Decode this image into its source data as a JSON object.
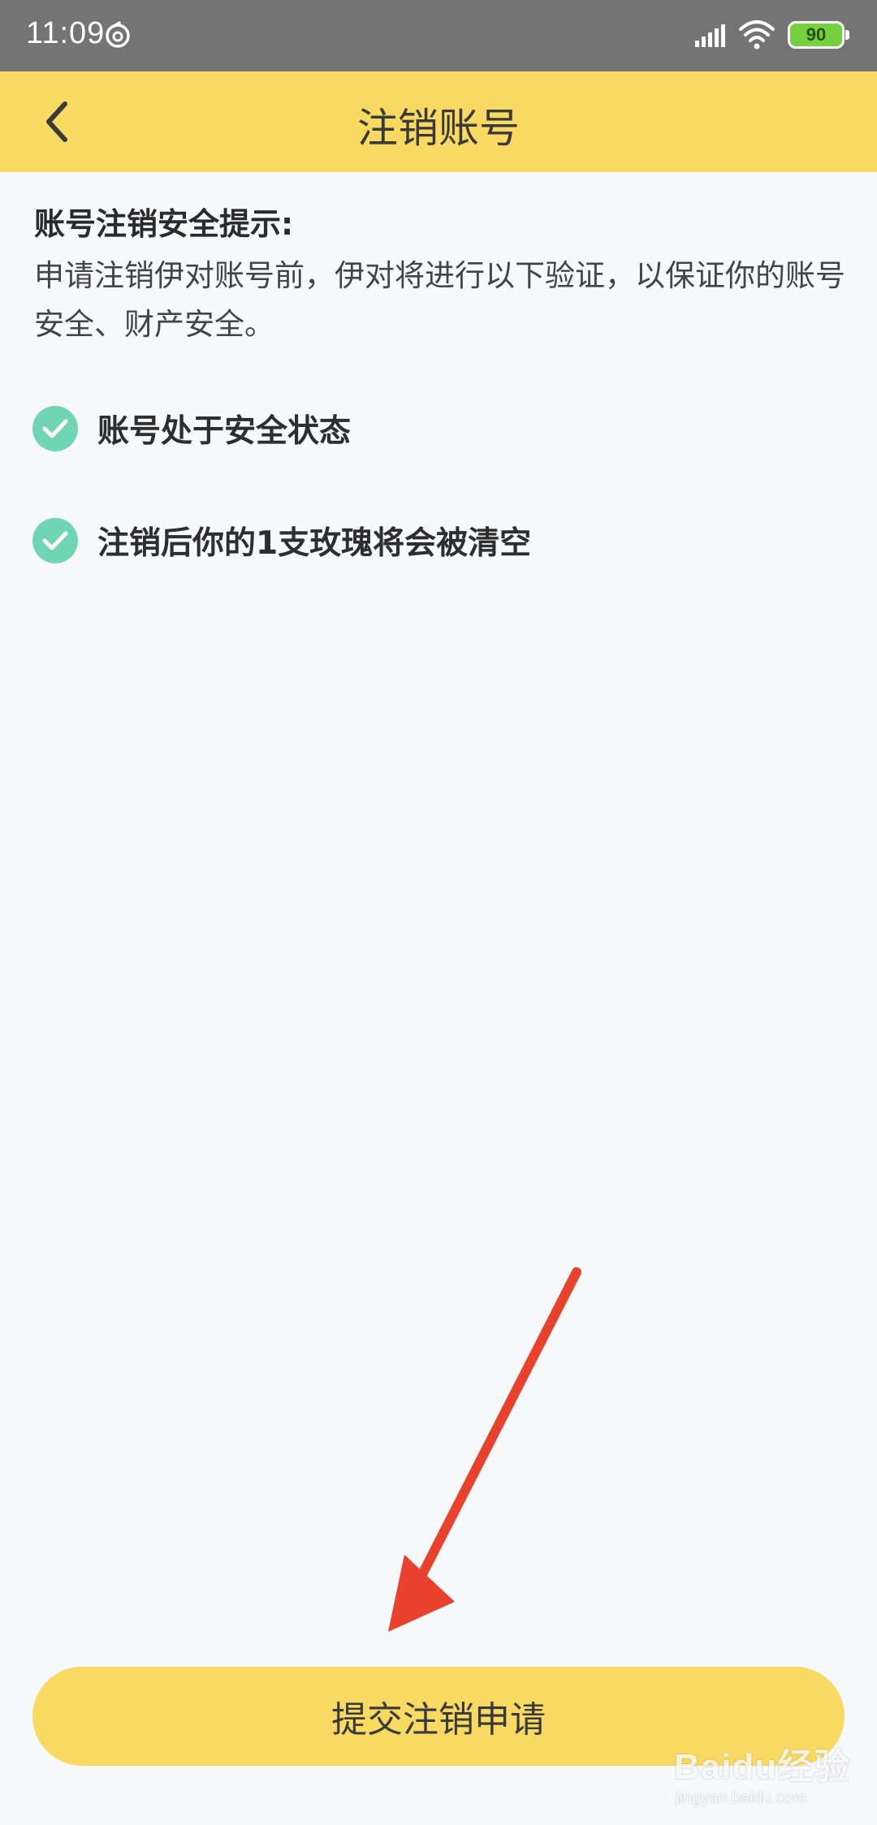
{
  "status_bar": {
    "time": "11:09",
    "battery": "90",
    "icons": [
      "netease-music-icon",
      "signal-icon",
      "wifi-icon",
      "battery-icon"
    ]
  },
  "title_bar": {
    "title": "注销账号",
    "back_icon": "chevron-left-icon"
  },
  "notice": {
    "heading": "账号注销安全提示:",
    "description": "申请注销伊对账号前，伊对将进行以下验证，以保证你的账号安全、财产安全。"
  },
  "checks": [
    {
      "label": "账号处于安全状态",
      "icon": "check-circle-icon"
    },
    {
      "label": "注销后你的1支玫瑰将会被清空",
      "icon": "check-circle-icon"
    }
  ],
  "submit_button": {
    "label": "提交注销申请"
  },
  "watermark": {
    "brand": "Baidu经验",
    "url": "jingyan.baidu.com"
  },
  "colors": {
    "accent": "#f8da62",
    "status_bar": "#747474",
    "check": "#6fd5b3",
    "arrow": "#e8412c",
    "background": "#f8f9fb"
  }
}
